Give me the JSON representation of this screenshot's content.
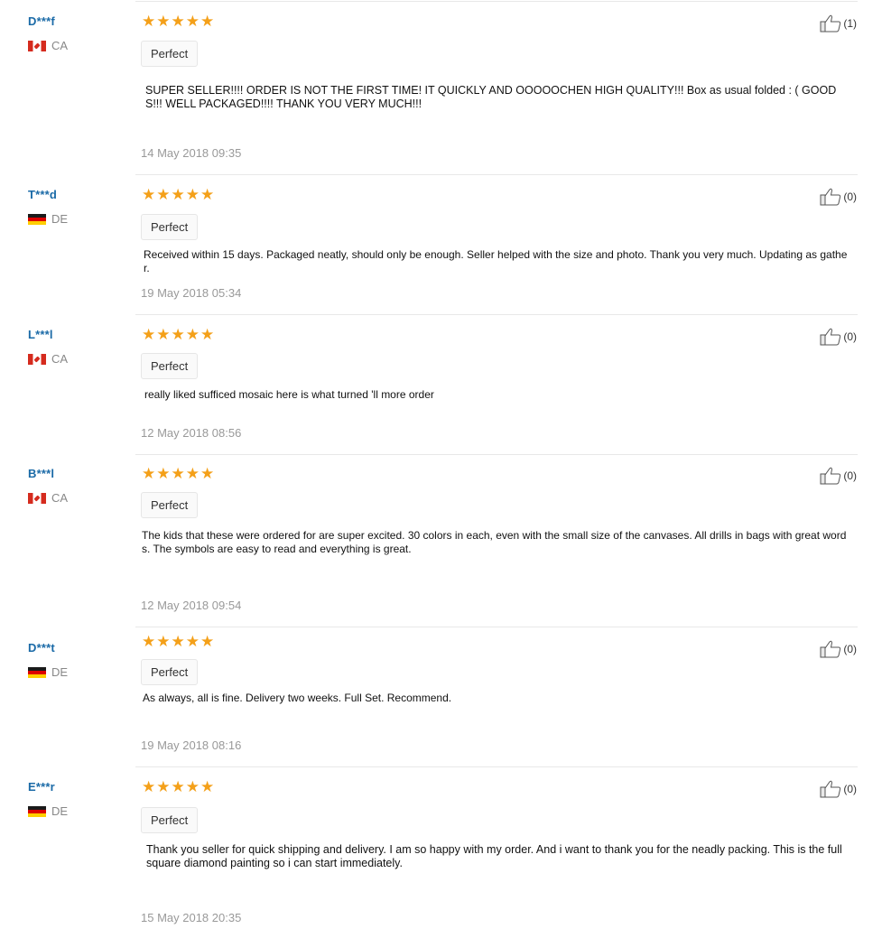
{
  "reviews": [
    {
      "username": "D***f",
      "country": "CA",
      "flag": "ca",
      "rating": 5,
      "tag": "Perfect",
      "likes": "(1)",
      "text": "SUPER SELLER!!!! ORDER IS NOT THE FIRST TIME! IT QUICKLY AND OOOOOCHEN HIGH QUALITY!!! Box as usual folded : ( GOODS!!! WELL PACKAGED!!!! THANK YOU VERY MUCH!!!",
      "date": "14 May 2018 09:35"
    },
    {
      "username": "T***d",
      "country": "DE",
      "flag": "de",
      "rating": 5,
      "tag": "Perfect",
      "likes": "(0)",
      "text": "Received within 15 days. Packaged neatly, should only be enough. Seller helped with the size and photo. Thank you very much. Updating as gather.",
      "date": "19 May 2018 05:34"
    },
    {
      "username": "L***l",
      "country": "CA",
      "flag": "ca",
      "rating": 5,
      "tag": "Perfect",
      "likes": "(0)",
      "text": "really liked sufficed mosaic here is what turned 'll more order",
      "date": "12 May 2018 08:56"
    },
    {
      "username": "B***l",
      "country": "CA",
      "flag": "ca",
      "rating": 5,
      "tag": "Perfect",
      "likes": "(0)",
      "text": "The kids that these were ordered for are super excited. 30 colors in each, even with the small size of the canvases. All drills in bags with great words. The symbols are easy to read and everything is great.",
      "date": "12 May 2018 09:54"
    },
    {
      "username": "D***t",
      "country": "DE",
      "flag": "de",
      "rating": 5,
      "tag": "Perfect",
      "likes": "(0)",
      "text": "As always, all is fine. Delivery two weeks. Full Set. Recommend.",
      "date": "19 May 2018 08:16"
    },
    {
      "username": "E***r",
      "country": "DE",
      "flag": "de",
      "rating": 5,
      "tag": "Perfect",
      "likes": "(0)",
      "text": "Thank you seller for quick shipping and delivery. I am so happy with my order. And i want to thank you for the neadly packing. This is the full square diamond painting so i can start immediately.",
      "date": "15 May 2018 20:35"
    }
  ]
}
